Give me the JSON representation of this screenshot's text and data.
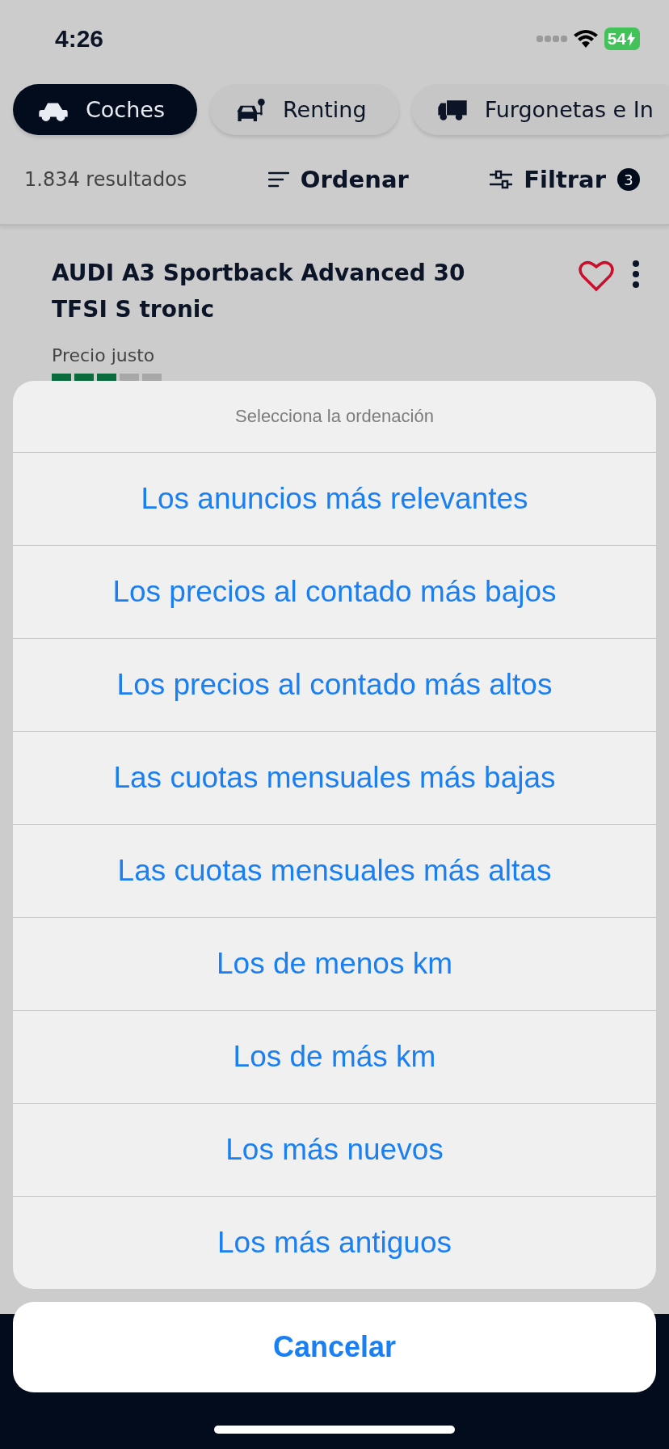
{
  "status_bar": {
    "time": "4:26",
    "battery": "54"
  },
  "categories": [
    {
      "label": "Coches",
      "selected": true,
      "kind": "car"
    },
    {
      "label": "Renting",
      "selected": false,
      "kind": "car-pin"
    },
    {
      "label": "Furgonetas e In",
      "selected": false,
      "kind": "truck"
    }
  ],
  "results_bar": {
    "count": "1.834 resultados",
    "sort": "Ordenar",
    "filter": "Filtrar",
    "filter_count": "3"
  },
  "listing": {
    "title": "AUDI A3 Sportback Advanced 30 TFSI S tronic",
    "price_label": "Precio justo",
    "price_rating": {
      "level": 0.6
    }
  },
  "action_sheet": {
    "title": "Selecciona la ordenación",
    "options": [
      "Los anuncios más relevantes",
      "Los precios al contado más bajos",
      "Los precios al contado más altos",
      "Las cuotas mensuales más bajas",
      "Las cuotas mensuales más altas",
      "Los de menos km",
      "Los de más km",
      "Los más nuevos",
      "Los más antiguos"
    ],
    "cancel": "Cancelar"
  }
}
